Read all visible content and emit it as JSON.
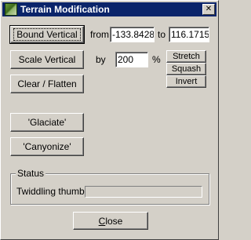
{
  "window": {
    "title": "Terrain Modification",
    "close_glyph": "✕"
  },
  "bound_vertical": {
    "button_label": "Bound Vertical",
    "from_label": "from",
    "from_value": "-133.8428",
    "to_label": "to",
    "to_value": "116.1715"
  },
  "scale_vertical": {
    "button_label": "Scale Vertical",
    "by_label": "by",
    "by_value": "200",
    "percent_label": "%",
    "stretch_label": "Stretch",
    "squash_label": "Squash",
    "invert_label": "Invert"
  },
  "clear_flatten_label": "Clear / Flatten",
  "glaciate_label": "'Glaciate'",
  "canyonize_label": "'Canyonize'",
  "status": {
    "group_label": "Status",
    "text": "Twiddling thumbs",
    "progress": 0
  },
  "close": {
    "prefix": "",
    "mnemonic": "C",
    "rest": "lose"
  },
  "colors": {
    "face": "#d4d0c8",
    "titlebar": "#0a246a"
  },
  "icons": {
    "app": "terrain-icon",
    "close": "close-icon"
  }
}
